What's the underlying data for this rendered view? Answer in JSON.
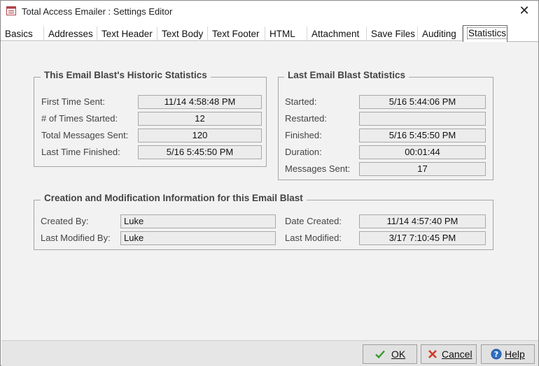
{
  "window": {
    "title": "Total Access Emailer : Settings Editor",
    "close_glyph": "✕"
  },
  "tabs": [
    {
      "label": "Basics"
    },
    {
      "label": "Addresses"
    },
    {
      "label": "Text Header"
    },
    {
      "label": "Text Body"
    },
    {
      "label": "Text Footer"
    },
    {
      "label": "HTML"
    },
    {
      "label": "Attachment"
    },
    {
      "label": "Save Files"
    },
    {
      "label": "Auditing"
    },
    {
      "label": "Statistics"
    }
  ],
  "active_tab": "Statistics",
  "historic": {
    "title": "This Email Blast's Historic Statistics",
    "first_sent_label": "First Time Sent:",
    "first_sent": "11/14   4:58:48 PM",
    "times_started_label": "# of Times Started:",
    "times_started": "12",
    "total_sent_label": "Total Messages Sent:",
    "total_sent": "120",
    "last_finished_label": "Last Time Finished:",
    "last_finished": "5/16   5:45:50 PM"
  },
  "last": {
    "title": "Last Email Blast Statistics",
    "started_label": "Started:",
    "started": "5/16   5:44:06 PM",
    "restarted_label": "Restarted:",
    "restarted": "",
    "finished_label": "Finished:",
    "finished": "5/16   5:45:50 PM",
    "duration_label": "Duration:",
    "duration": "00:01:44",
    "messages_label": "Messages Sent:",
    "messages": "17"
  },
  "creation": {
    "title": "Creation and Modification Information for this Email Blast",
    "created_by_label": "Created By:",
    "created_by": "Luke",
    "modified_by_label": "Last Modified By:",
    "modified_by": "Luke",
    "date_created_label": "Date Created:",
    "date_created": "11/14   4:57:40 PM",
    "last_modified_label": "Last Modified:",
    "last_modified": "3/17   7:10:45 PM"
  },
  "buttons": {
    "ok": "OK",
    "cancel": "Cancel",
    "help": "Help"
  },
  "colors": {
    "ok_check": "#3a9a2e",
    "cancel_x": "#d33a2a",
    "help_blue": "#2f6fc4",
    "panel_bg": "#f2f2f2"
  }
}
